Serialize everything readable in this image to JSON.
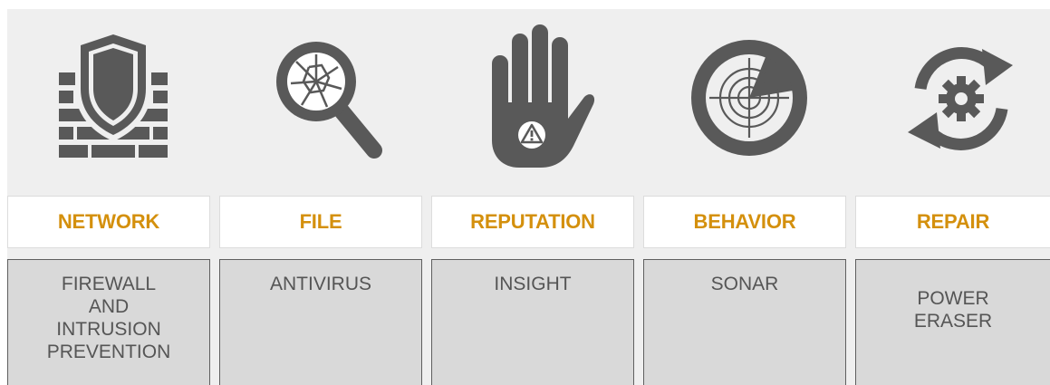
{
  "colors": {
    "icon": "#595959",
    "label_text": "#d4900d",
    "tech_text": "#555555",
    "panel_bg": "#efefef",
    "tech_bg": "#d9d9d9"
  },
  "columns": [
    {
      "category": "NETWORK",
      "technology": "FIREWALL\nAND\nINTRUSION\nPREVENTION",
      "icon": "shield-brick-wall-icon"
    },
    {
      "category": "FILE",
      "technology": "ANTIVIRUS",
      "icon": "magnifier-cracked-glass-icon"
    },
    {
      "category": "REPUTATION",
      "technology": "INSIGHT",
      "icon": "hand-warning-icon"
    },
    {
      "category": "BEHAVIOR",
      "technology": "SONAR",
      "icon": "radar-icon"
    },
    {
      "category": "REPAIR",
      "technology": "POWER\nERASER",
      "icon": "gear-refresh-icon"
    }
  ]
}
